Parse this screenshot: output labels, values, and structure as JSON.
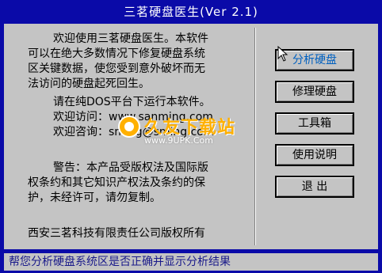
{
  "window": {
    "title": "三茗硬盘医生(Ver 2.1)"
  },
  "intro": {
    "lines": [
      "欢迎使用三茗硬盘医生。本软件",
      "可以在绝大多数情况下修复硬盘系统",
      "区关键数据，使您受到意外破坏而无",
      "法访问的硬盘起死回生。",
      "请在纯DOS平台下运行本软件。",
      "欢迎访问：www.sanming.com",
      "欢迎咨询：sming@sming.com"
    ]
  },
  "warning": {
    "lines": [
      "警告：本产品受版权法及国际版",
      "权条约和其它知识产权法及条约的保",
      "护，未经许可，请勿复制。"
    ]
  },
  "copyright": "西安三茗科技有限责任公司版权所有",
  "menu": {
    "analyze": "分析硬盘",
    "repair": "修理硬盘",
    "toolbox": "工具箱",
    "help": "使用说明",
    "exit": "退  出"
  },
  "status": "帮您分析硬盘系统区是否正确并显示分析结果",
  "watermark": {
    "brand": "久友下载站",
    "url": "www.9UPK.Com"
  },
  "colors": {
    "background": "#0a0aa8",
    "panel": "#c4c4c4",
    "active_button_text": "#0060c0",
    "status_text": "#1a1a8a"
  }
}
